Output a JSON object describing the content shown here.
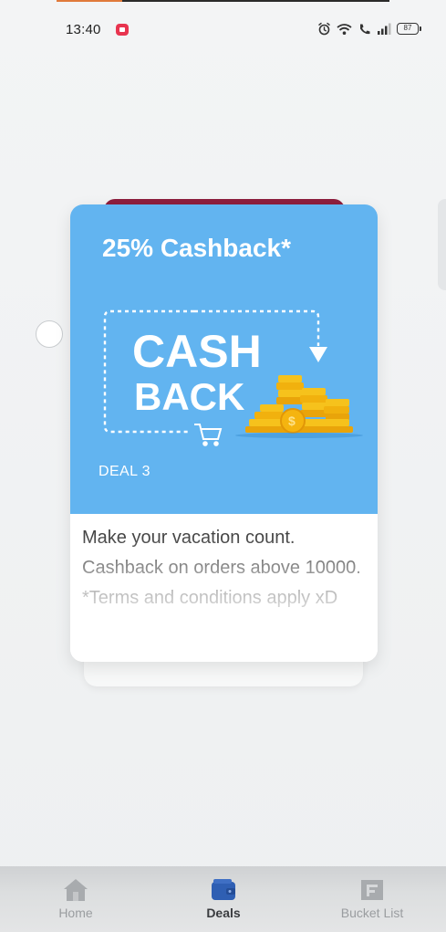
{
  "status_bar": {
    "time": "13:40",
    "battery": "87",
    "icons": [
      "notification-icon",
      "alarm-icon",
      "wifi-icon",
      "call-icon",
      "signal-icon",
      "battery-icon"
    ]
  },
  "deal_card": {
    "title": "25% Cashback*",
    "art_text_line1": "CASH",
    "art_text_line2": "BACK",
    "deal_label": "DEAL 3",
    "description": "Make your vacation count. Cashback on orders above 10000. *Terms and conditions apply xD",
    "hero_color": "#62b4f0"
  },
  "bottom_nav": {
    "items": [
      {
        "label": "Home",
        "icon": "home-icon",
        "active": false
      },
      {
        "label": "Deals",
        "icon": "wallet-icon",
        "active": true
      },
      {
        "label": "Bucket List",
        "icon": "bucket-list-icon",
        "active": false
      }
    ],
    "active_color": "#2f5fb3"
  }
}
